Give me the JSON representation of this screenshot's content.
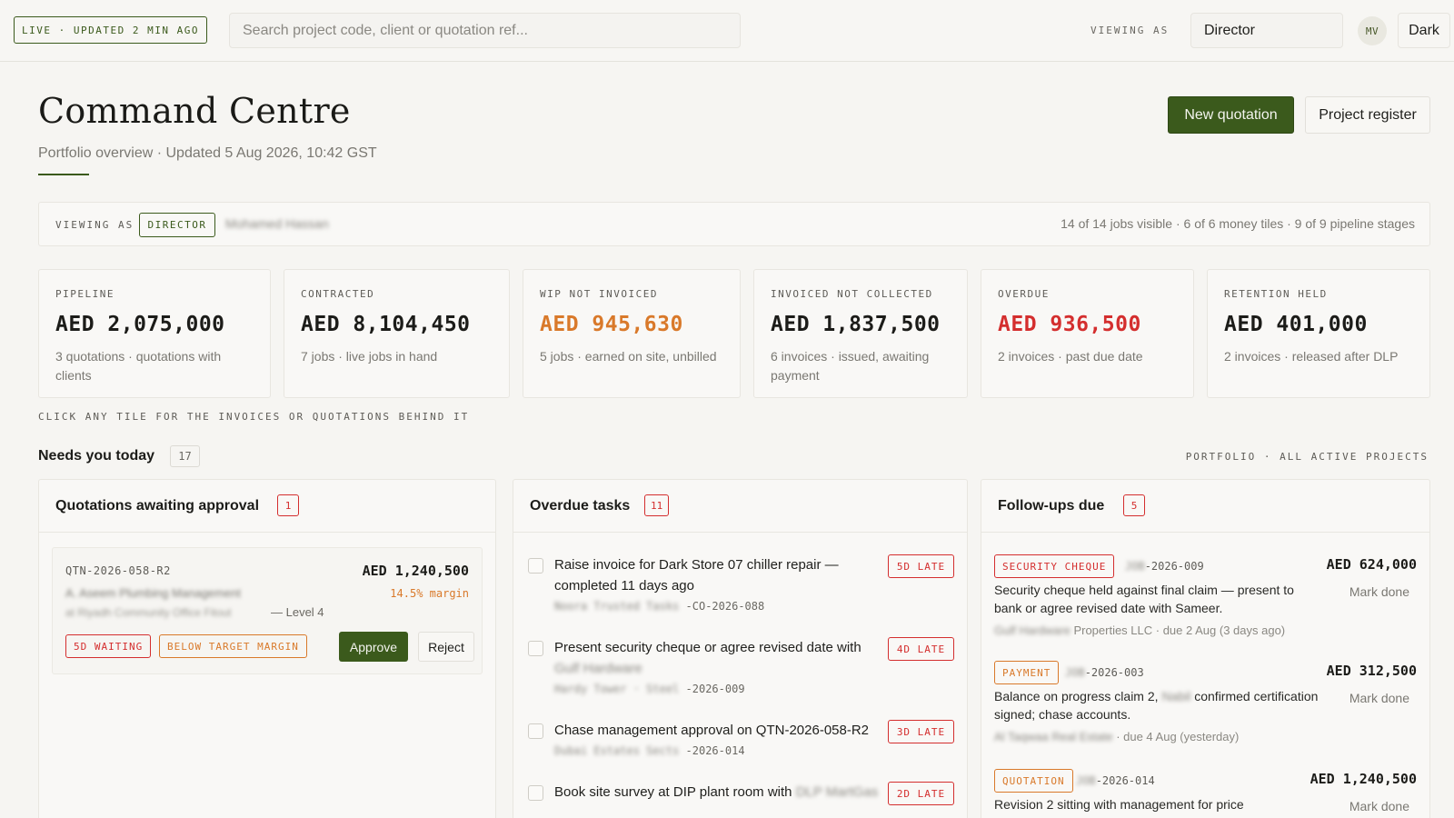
{
  "topbar": {
    "live_badge": "LIVE · UPDATED 2 MIN AGO",
    "search_placeholder": "Search project code, client or quotation ref...",
    "viewing_as_label": "VIEWING AS",
    "role": "Director",
    "avatar_initials": "MV",
    "theme_toggle": "Dark"
  },
  "header": {
    "title": "Command Centre",
    "subtitle": "Portfolio overview · Updated 5 Aug 2026, 10:42 GST",
    "new_quotation": "New quotation",
    "project_register": "Project register"
  },
  "viewing_bar": {
    "label": "VIEWING AS",
    "role_badge": "DIRECTOR",
    "user_name": "Mohamed Hassan",
    "stats": "14 of 14 jobs visible · 6 of 6 money tiles · 9 of 9 pipeline stages"
  },
  "tiles": [
    {
      "label": "PIPELINE",
      "value": "AED 2,075,000",
      "desc": "3 quotations · quotations with clients",
      "status": "normal"
    },
    {
      "label": "CONTRACTED",
      "value": "AED 8,104,450",
      "desc": "7 jobs · live jobs in hand",
      "status": "normal"
    },
    {
      "label": "WIP NOT INVOICED",
      "value": "AED 945,630",
      "desc": "5 jobs · earned on site, unbilled",
      "status": "warn"
    },
    {
      "label": "INVOICED NOT COLLECTED",
      "value": "AED 1,837,500",
      "desc": "6 invoices · issued, awaiting payment",
      "status": "normal"
    },
    {
      "label": "OVERDUE",
      "value": "AED 936,500",
      "desc": "2 invoices · past due date",
      "status": "danger"
    },
    {
      "label": "RETENTION HELD",
      "value": "AED 401,000",
      "desc": "2 invoices · released after DLP",
      "status": "normal"
    }
  ],
  "tiles_hint": "CLICK ANY TILE FOR THE INVOICES OR QUOTATIONS BEHIND IT",
  "needs_today": {
    "title": "Needs you today",
    "count": "17",
    "scope": "PORTFOLIO · ALL ACTIVE PROJECTS"
  },
  "quotations_panel": {
    "title": "Quotations awaiting approval",
    "count": "1",
    "card": {
      "ref": "QTN-2026-058-R2",
      "amount": "AED 1,240,500",
      "client": "A. Aseem Plumbing Management",
      "margin": "14.5% margin",
      "location": "at Riyadh Community Office Fitout",
      "level": "— Level 4",
      "tag_waiting": "5D WAITING",
      "tag_margin": "BELOW TARGET MARGIN",
      "approve": "Approve",
      "reject": "Reject"
    }
  },
  "tasks_panel": {
    "title": "Overdue tasks",
    "count": "11",
    "tasks": [
      {
        "text": "Raise invoice for Dark Store 07 chiller repair — completed 11 days ago",
        "meta_blur": "Noora Trusted Tasks",
        "meta_ref": "-CO-2026-088",
        "late": "5D LATE"
      },
      {
        "text": "Present security cheque or agree revised date with",
        "text_blur": "Gulf Hardware",
        "meta_blur": "Hardy Tower · Steel",
        "meta_ref": "-2026-009",
        "late": "4D LATE"
      },
      {
        "text": "Chase management approval on QTN-2026-058-R2",
        "meta_blur": "Dubai Estates Sects",
        "meta_ref": "-2026-014",
        "late": "3D LATE"
      },
      {
        "text": "Book site survey at DIP plant room with",
        "text_blur": "DLP MartGas",
        "meta_blur": "",
        "meta_ref": "",
        "late": "2D LATE"
      }
    ]
  },
  "followups_panel": {
    "title": "Follow-ups due",
    "count": "5",
    "items": [
      {
        "tag": "SECURITY CHEQUE",
        "ref_blur": "JOB",
        "ref": "-2026-009",
        "amount": "AED 624,000",
        "text": "Security cheque held against final claim — present to bank or agree revised date with Sameer.",
        "meta_blur": "Gulf Hardware",
        "meta": "Properties LLC · due 2 Aug (3 days ago)",
        "action": "Mark done"
      },
      {
        "tag": "PAYMENT",
        "ref_blur": "JOB",
        "ref": "-2026-003",
        "amount": "AED 312,500",
        "text_pre": "Balance on progress claim 2,",
        "text_blur": "Nabil",
        "text_post": "confirmed certification signed; chase accounts.",
        "meta_blur": "Al Taqwaa Real Estate",
        "meta": "· due 4 Aug (yesterday)",
        "action": "Mark done"
      },
      {
        "tag": "QUOTATION",
        "ref_blur": "JOB",
        "ref": "-2026-014",
        "amount": "AED 1,240,500",
        "text": "Revision 2 sitting with management for price",
        "action": "Mark done"
      }
    ]
  },
  "colors": {
    "accent": "#3b5a1c",
    "warn": "#d9792a",
    "danger": "#d42e2e"
  }
}
